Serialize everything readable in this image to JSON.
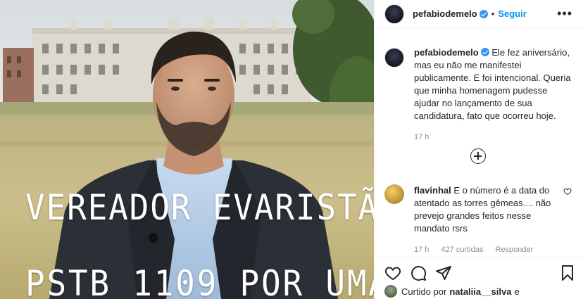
{
  "photo": {
    "overlay_line1": "VEREADOR EVARISTÃO",
    "overlay_line2": "PSTB 1109  POR UMA"
  },
  "header": {
    "username": "pefabiodemelo",
    "separator": "•",
    "follow_label": "Seguir",
    "more_label": "•••",
    "verified_icon": "verified-badge-icon"
  },
  "caption": {
    "username": "pefabiodemelo",
    "text": "Ele fez aniversário, mas eu não me manifestei publicamente. E foi intencional. Queria que minha homenagem pudesse ajudar no lançamento de sua candidatura, fato que ocorreu hoje.",
    "time": "17 h"
  },
  "comment": {
    "username": "flavinhal",
    "text": "E o número é a data do atentado as torres gêmeas.... não prevejo grandes feitos nesse mandato rsrs",
    "time": "17 h",
    "likes": "427 curtidas",
    "reply_label": "Responder"
  },
  "actions": {
    "icons": [
      "heart-icon",
      "comment-icon",
      "share-icon",
      "bookmark-icon"
    ]
  },
  "likes": {
    "prefix": "Curtido por",
    "user": "nataliia__silva",
    "suffix": "e"
  },
  "colors": {
    "accent": "#0095f6",
    "verified": "#3897f0",
    "muted": "#8e8e8e",
    "text": "#262626"
  }
}
